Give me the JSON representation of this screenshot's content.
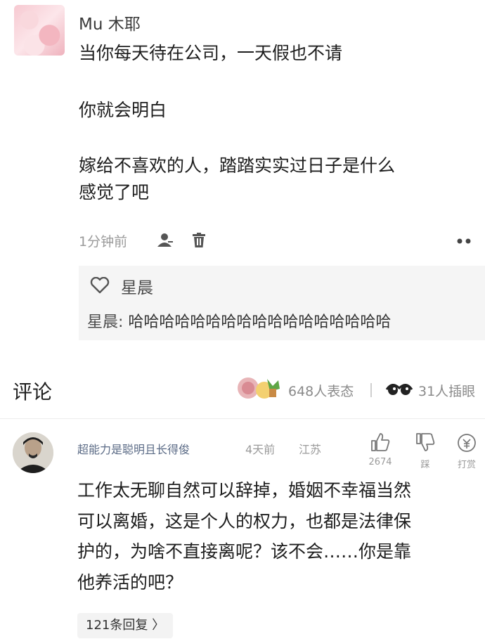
{
  "post": {
    "username": "Mu 木耶",
    "lines": [
      "当你每天待在公司，一天假也不请",
      "你就会明白",
      "嫁给不喜欢的人，踏踏实实过日子是什么",
      "感觉了吧"
    ],
    "time": "1分钟前",
    "likes": {
      "liker": "星晨"
    },
    "reply": {
      "author": "星晨:",
      "text": "哈哈哈哈哈哈哈哈哈哈哈哈哈哈哈哈哈"
    }
  },
  "comments_section": {
    "title": "评论",
    "reactions": "648人表态",
    "views": "31人插眼"
  },
  "comment": {
    "author": "超能力是聪明且长得俊",
    "time": "4天前",
    "location": "江苏",
    "like_count": "2674",
    "dislike_label": "踩",
    "tip_label": "打赏",
    "lines": [
      "工作太无聊自然可以辞掉，婚姻不幸福当然",
      "可以离婚，这是个人的权力，也都是法律保",
      "护的，为啥不直接离呢？该不会……你是靠",
      "他养活的吧？"
    ],
    "replies_label": "121条回复 〉"
  }
}
